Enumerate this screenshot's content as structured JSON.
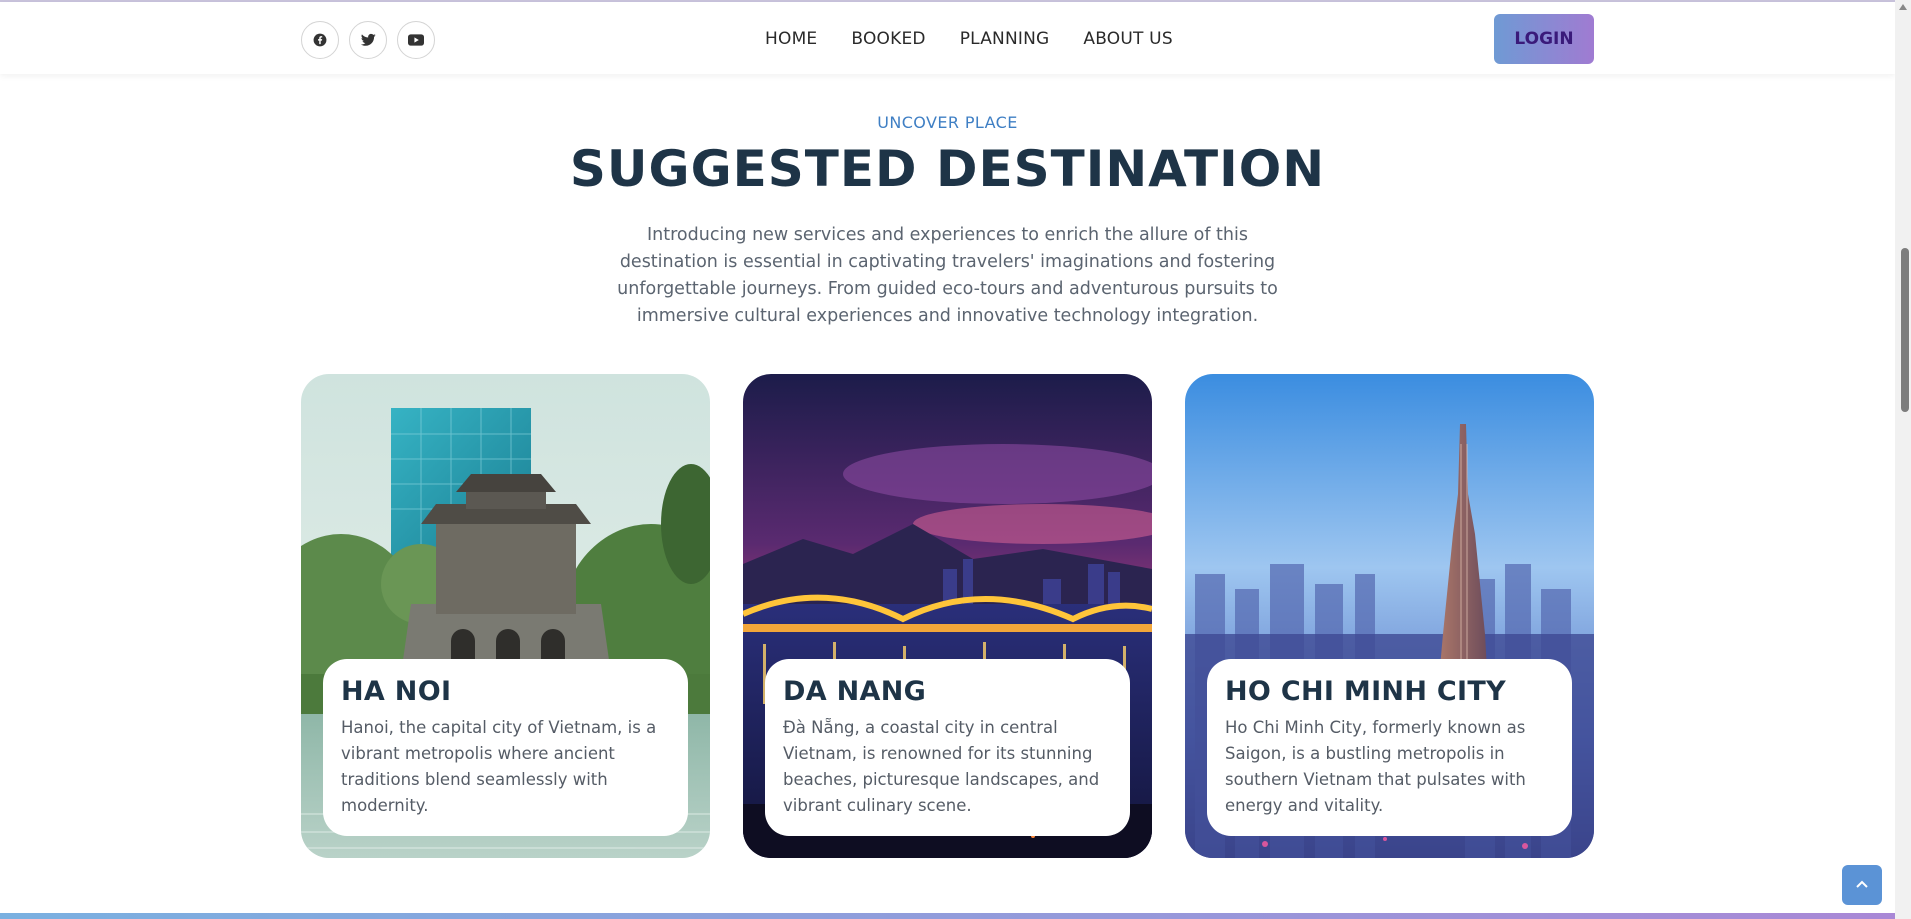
{
  "header": {
    "socials": [
      {
        "icon": "facebook-icon",
        "label": "Facebook"
      },
      {
        "icon": "twitter-icon",
        "label": "Twitter"
      },
      {
        "icon": "youtube-icon",
        "label": "YouTube"
      }
    ],
    "nav": [
      "HOME",
      "BOOKED",
      "PLANNING",
      "ABOUT US"
    ],
    "login_label": "LOGIN"
  },
  "section": {
    "eyebrow": "UNCOVER PLACE",
    "title": "SUGGESTED DESTINATION",
    "intro": "Introducing new services and experiences to enrich the allure of this destination is essential in captivating travelers' imaginations and fostering unforgettable journeys. From guided eco-tours and adventurous pursuits to immersive cultural experiences and innovative technology integration."
  },
  "destinations": [
    {
      "name": "HA NOI",
      "description": "Hanoi, the capital city of Vietnam, is a vibrant metropolis where ancient traditions blend seamlessly with modernity."
    },
    {
      "name": "DA NANG",
      "description": "Đà Nẵng, a coastal city in central Vietnam, is renowned for its stunning beaches, picturesque landscapes, and vibrant culinary scene."
    },
    {
      "name": "HO CHI MINH CITY",
      "description": "Ho Chi Minh City, formerly known as Saigon, is a bustling metropolis in southern Vietnam that pulsates with energy and vitality."
    }
  ],
  "colors": {
    "accent": "#3f7fc4",
    "heading": "#1e3447",
    "login_gradient_start": "#6f9ad4",
    "login_gradient_end": "#a07bd2"
  }
}
